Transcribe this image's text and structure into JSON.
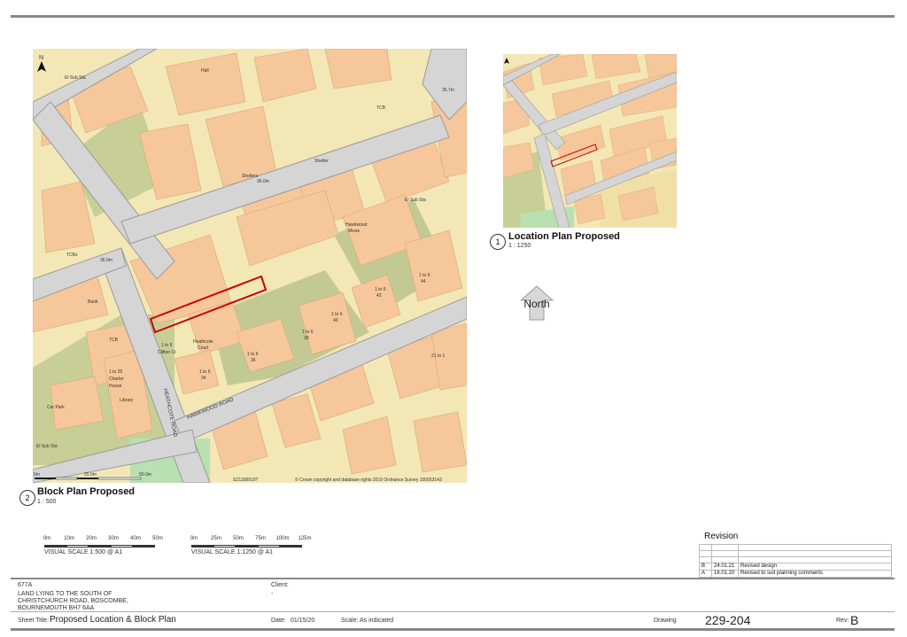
{
  "block_plan": {
    "number": "2",
    "title": "Block Plan Proposed",
    "scale": "1 : 500",
    "map": {
      "north_label": "N",
      "copyright": "© Crown copyright and database rights 2019 Ordnance Survey 100053143",
      "grid_ref": "SZ1168919?",
      "scalebar_labels": [
        "0m",
        "25.0m",
        "50.0m"
      ],
      "roads": [
        "HEATHCOTE ROAD",
        "HAWKWOOD ROAD"
      ],
      "labels": [
        "El Sub Sta",
        "Hall",
        "Shelter",
        "Shelters",
        "36.0m",
        "35.7m",
        "TCB",
        "TCBs",
        "36.0m",
        "Bank",
        "TCB",
        "1 to 25",
        "Charter",
        "House",
        "Library",
        "Car Park",
        "El Sub Sta",
        "El Sub Sta",
        "Heathcote",
        "Court",
        "1 to 6",
        "Clifton Ct",
        "Hawkwood",
        "Mews",
        "1 to 6",
        "1 to 6",
        "1 to 6",
        "1 to 6",
        "1 to 6",
        "1 to 6",
        "44",
        "42",
        "40",
        "38",
        "36",
        "34",
        "21 to 1"
      ]
    }
  },
  "location_plan": {
    "number": "1",
    "title": "Location Plan Proposed",
    "scale": "1 : 1250"
  },
  "north_arrow": {
    "label": "North"
  },
  "scales": [
    {
      "labels": [
        "0m",
        "10m",
        "20m",
        "30m",
        "40m",
        "50m"
      ],
      "caption": "VISUAL SCALE 1:500  @ A1"
    },
    {
      "labels": [
        "0m",
        "25m",
        "50m",
        "75m",
        "100m",
        "125m"
      ],
      "caption": "VISUAL SCALE 1:1250  @ A1"
    }
  ],
  "revision": {
    "heading": "Revision",
    "rows": [
      {
        "rev": "",
        "date": "",
        "desc": ""
      },
      {
        "rev": "",
        "date": "",
        "desc": ""
      },
      {
        "rev": "",
        "date": "",
        "desc": ""
      },
      {
        "rev": "B",
        "date": "24.01.21",
        "desc": "Revised design"
      },
      {
        "rev": "A",
        "date": "16.01.20",
        "desc": "Revised to suit planning comments"
      }
    ]
  },
  "title_block": {
    "job_number": "677A",
    "address_lines": [
      "LAND LYING TO THE SOUTH OF",
      "CHRISTCHURCH ROAD, BOSCOMBE,",
      "BOURNEMOUTH BH7 6AA"
    ],
    "client_label": "Client:",
    "client_value": "-",
    "sheet_title_label": "Sheet Title:",
    "sheet_title": "Proposed Location & Block Plan",
    "date_label": "Date:",
    "date": "01/15/20",
    "scale_label": "Scale:",
    "scale": "As indicated",
    "drawing_label": "Drawing",
    "drawing_number": "229-204",
    "rev_label": "Rev:",
    "rev": "B"
  }
}
